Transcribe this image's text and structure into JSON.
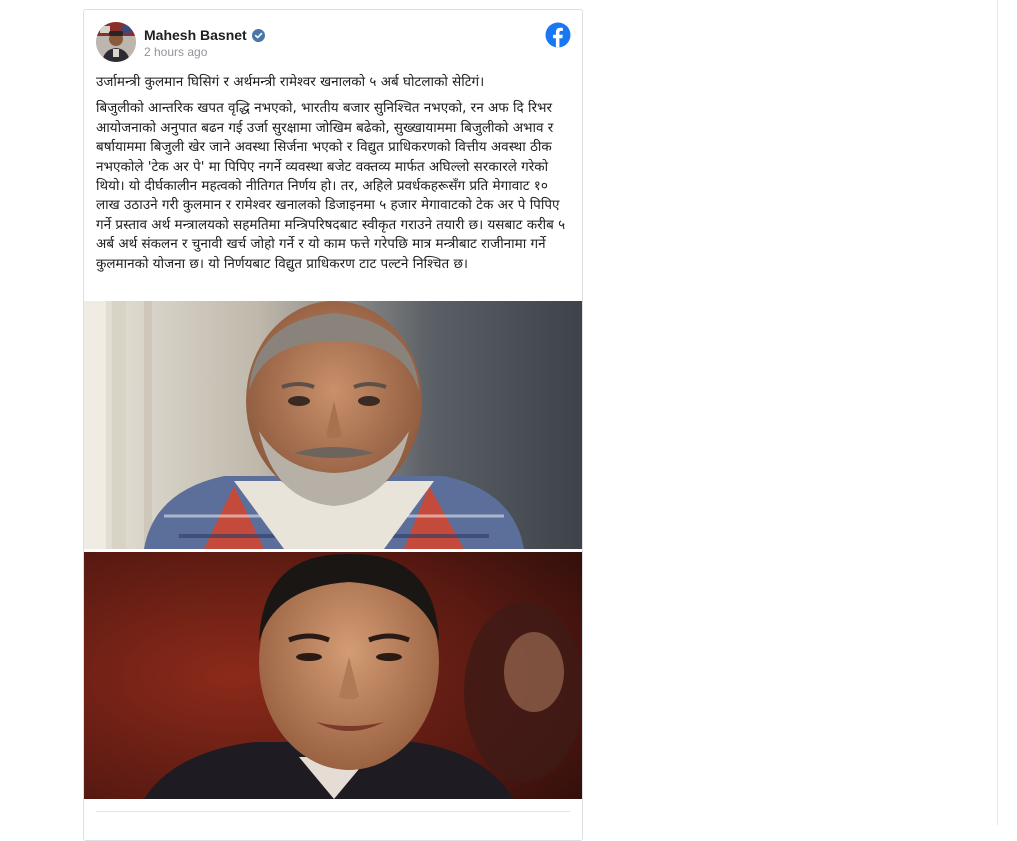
{
  "post": {
    "author_name": "Mahesh Basnet",
    "timestamp": "2 hours ago",
    "verified": true,
    "paragraphs": [
      "उर्जामन्त्री कुलमान घिसिगं र अर्थमन्त्री रामेश्वर खनालको ५ अर्ब घोटलाको सेटिगं।",
      "बिजुलीको आन्तरिक खपत वृद्धि नभएको, भारतीय बजार सुनिश्चित नभएको, रन अफ दि रिभर आयोजनाको अनुपात बढन गई उर्जा सुरक्षामा जोखिम बढेको, सुख्खायाममा बिजुलीको अभाव र बर्षायाममा बिजुली खेर जाने अवस्था सिर्जना भएको र विद्युत प्राधिकरणको वित्तीय अवस्था ठीक नभएकोले 'टेक अर पे' मा पिपिए नगर्ने व्यवस्था बजेट वक्तव्य मार्फत अघिल्लो सरकारले गरेको थियो। यो दीर्घकालीन महत्वको नीतिगत निर्णय हो। तर, अहिले प्रवर्धकहरूसँग प्रति मेगावाट १० लाख उठाउने गरी कुलमान र रामेश्वर खनालको डिजाइनमा ५ हजार मेगावाटको टेक अर पे पिपिए गर्ने प्रस्ताव अर्थ मन्त्रालयको सहमतिमा मन्त्रिपरिषदबाट स्वीकृत गराउने तयारी छ। यसबाट करीब ५ अर्ब अर्थ संकलन र चुनावी खर्च जोहो गर्ने र यो काम फत्ते गरेपछि मात्र मन्त्रीबाट राजीनामा गर्ने कुलमानको योजना छ। यो निर्णयबाट विद्युत प्राधिकरण टाट पल्टने निश्चित छ।"
    ]
  },
  "colors": {
    "facebook_blue": "#1877f2",
    "author_text": "#1c1e21",
    "timestamp_text": "#90949c",
    "card_border": "#dddfe2"
  },
  "icons": {
    "platform": "facebook-icon",
    "verified": "verified-badge-icon"
  }
}
